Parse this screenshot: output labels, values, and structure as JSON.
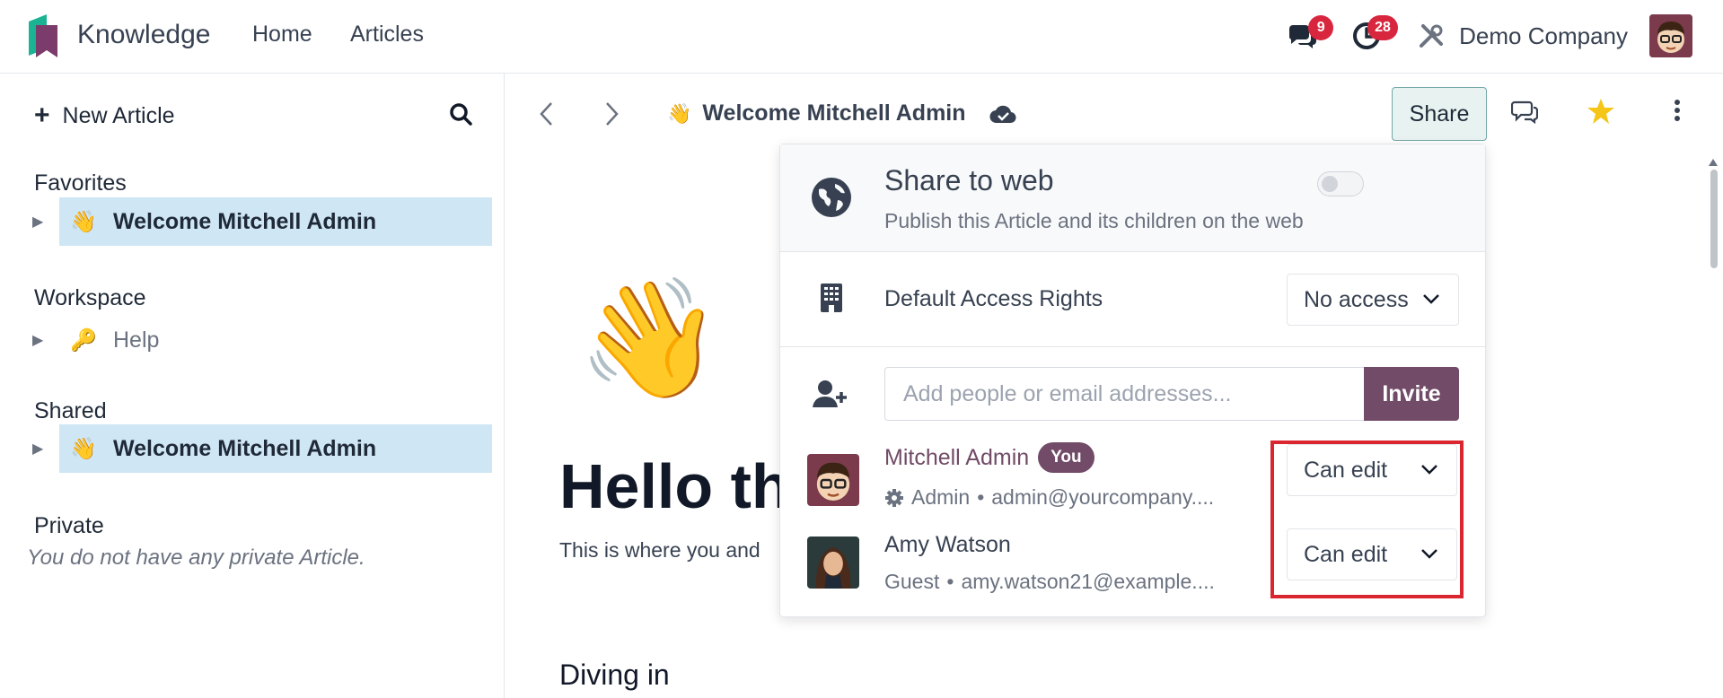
{
  "app": {
    "name": "Knowledge"
  },
  "topnav": {
    "links": [
      "Home",
      "Articles"
    ],
    "messages_count": "9",
    "activities_count": "28",
    "company": "Demo Company"
  },
  "sidebar": {
    "new_article_label": "New Article",
    "sections": {
      "favorites": {
        "title": "Favorites",
        "items": [
          {
            "emoji": "👋",
            "label": "Welcome Mitchell Admin"
          }
        ]
      },
      "workspace": {
        "title": "Workspace",
        "items": [
          {
            "emoji": "🔑",
            "label": "Help"
          }
        ]
      },
      "shared": {
        "title": "Shared",
        "items": [
          {
            "emoji": "👋",
            "label": "Welcome Mitchell Admin"
          }
        ]
      },
      "private": {
        "title": "Private",
        "empty_text": "You do not have any private Article."
      }
    }
  },
  "article": {
    "breadcrumb_emoji": "👋",
    "title": "Welcome Mitchell Admin",
    "icon_emoji": "👋",
    "heading_visible": "Hello th",
    "intro_visible": "This is where you and",
    "section_heading": "Diving in"
  },
  "toolbar": {
    "share_label": "Share"
  },
  "share_panel": {
    "web_title": "Share to web",
    "web_subtitle": "Publish this Article and its children on the web",
    "web_enabled": false,
    "access_label": "Default Access Rights",
    "access_value": "No access",
    "invite_placeholder": "Add people or email addresses...",
    "invite_label": "Invite",
    "members": [
      {
        "name": "Mitchell Admin",
        "badge": "You",
        "role": "Admin",
        "email": "admin@yourcompany....",
        "permission": "Can edit"
      },
      {
        "name": "Amy Watson",
        "role": "Guest",
        "email": "amy.watson21@example....",
        "permission": "Can edit"
      }
    ]
  },
  "colors": {
    "brand": "#714b67",
    "accent_teal": "#73a7a7",
    "badge_red": "#d9263f",
    "highlight_red": "#d9262f",
    "active_item": "#cfe6f4"
  }
}
